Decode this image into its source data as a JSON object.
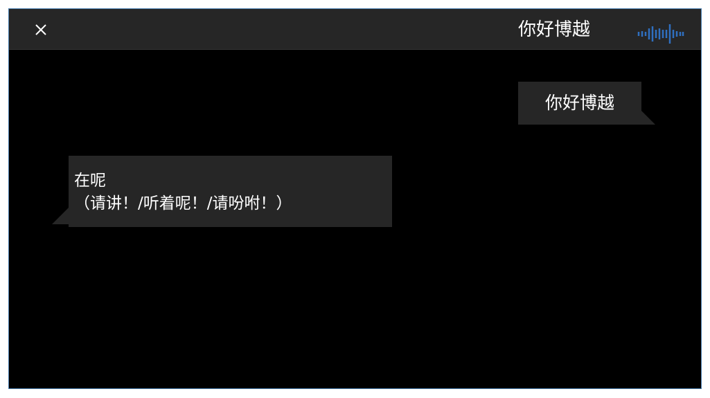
{
  "header": {
    "title": "你好博越",
    "close_icon": "close-icon",
    "voice_icon": "voice-wave-icon",
    "voice_color": "#2f6fc0"
  },
  "conversation": {
    "user_message": "你好博越",
    "bot_reply_line1": "在呢",
    "bot_reply_line2": "（请讲！/听着呢！/请吩咐！）"
  },
  "colors": {
    "background": "#000000",
    "titlebar": "#262626",
    "bubble": "#262626",
    "text": "#ffffff",
    "window_border": "#4a7fb0"
  }
}
